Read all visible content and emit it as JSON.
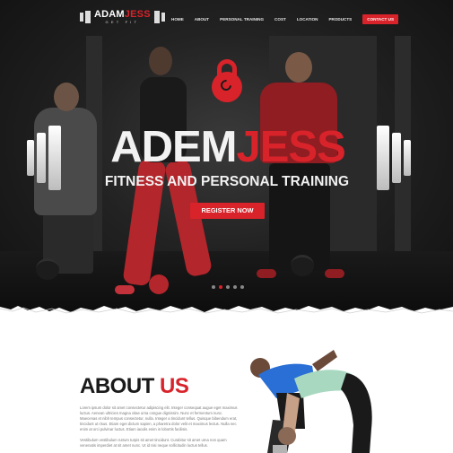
{
  "brand": {
    "logo_main_white": "ADAM",
    "logo_main_red": "JESS",
    "logo_sub": "GET FIT"
  },
  "nav": {
    "items": [
      "HOME",
      "ABOUT",
      "PERSONAL TRAINING",
      "COST",
      "LOCATION",
      "PRODUCTS"
    ],
    "contact_label": "CONTACT US"
  },
  "hero": {
    "title_white": "ADEM",
    "title_red": "JESS",
    "subtitle": "FITNESS AND PERSONAL TRAINING",
    "cta_label": "REGISTER NOW",
    "slide_count": 5,
    "active_slide": 1
  },
  "about": {
    "title_dark": "ABOUT",
    "title_red": "US",
    "paragraph_1": "Lorem ipsum dolor sit amet consectetur adipiscing elit. Integer consequat augue eget maximus luctus. Aenean ultricies magna vitae urna congue dignissim. Nunc et fermentum nunc. Maecenas et nibh tempus consectetur, nulla. Integer a tincidunt tellus. Quisque bibendum erat, tincidunt ut risus. Etiam eget dictum sapien, a pharetra dolor velit et maximus lectus. Nulla nec enim at orci pulvinar luctus. Etiam iaculis enim in lobortis facilisis.",
    "paragraph_2": "Vestibulum vestibulum rutrum turpis sit amet tincidunt. Curabitur sit amet urna non quam venenatis imperdiet at sit amet nunc. Ut id nisi neque sollicitudin luctus tellus."
  },
  "colors": {
    "accent": "#d8232a",
    "hero_bg": "#1a1a1a",
    "text_dark": "#1a1a1a",
    "body_text": "#7a7a7a"
  }
}
